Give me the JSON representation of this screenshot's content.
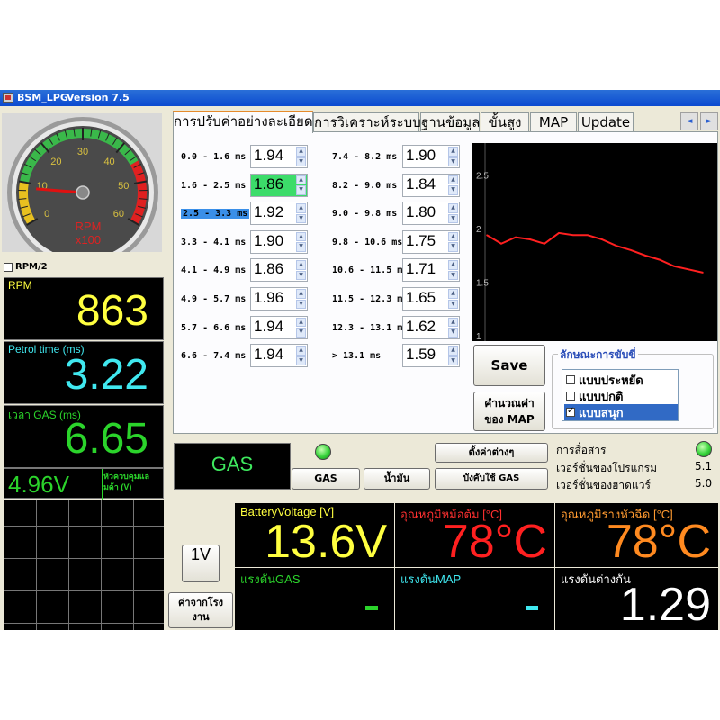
{
  "window": {
    "title": "BSM_LPG",
    "version": "Version 7.5"
  },
  "gauge": {
    "tick_labels": [
      "0",
      "10",
      "20",
      "30",
      "40",
      "50",
      "60"
    ],
    "unit_line1": "RPM",
    "unit_line2": "x100",
    "needle_value": 8.63
  },
  "rpm2": {
    "label": "RPM/2",
    "checked": false
  },
  "readouts": [
    {
      "label": "RPM",
      "value": "863",
      "label_color": "#ffff40",
      "value_color": "#ffff40"
    },
    {
      "label": "Petrol time (ms)",
      "value": "3.22",
      "label_color": "#40e8f0",
      "value_color": "#40e8f0"
    },
    {
      "label": "เวลา GAS (ms)",
      "value": "6.65",
      "label_color": "#2bd42b",
      "value_color": "#2bd42b"
    }
  ],
  "voltage": {
    "value": "4.96V",
    "label": "หัวควบคุมแลมด้า (V)"
  },
  "tabs": [
    "การปรับค่าอย่างละเอียด",
    "การวิเคราะห์ระบบ",
    "ฐานข้อมูล",
    "ขั้นสูง",
    "MAP",
    "Update"
  ],
  "tab_scroll": {
    "left": "◄",
    "right": "►"
  },
  "ranges_left": [
    {
      "label": "0.0 - 1.6 ms",
      "value": "1.94"
    },
    {
      "label": "1.6 - 2.5 ms",
      "value": "1.86"
    },
    {
      "label": "2.5 - 3.3 ms",
      "value": "1.92"
    },
    {
      "label": "3.3 - 4.1 ms",
      "value": "1.90"
    },
    {
      "label": "4.1 - 4.9 ms",
      "value": "1.86"
    },
    {
      "label": "4.9 - 5.7 ms",
      "value": "1.96"
    },
    {
      "label": "5.7 - 6.6 ms",
      "value": "1.94"
    },
    {
      "label": "6.6 - 7.4 ms",
      "value": "1.94"
    }
  ],
  "ranges_right": [
    {
      "label": "7.4 - 8.2 ms",
      "value": "1.90"
    },
    {
      "label": "8.2 - 9.0 ms",
      "value": "1.84"
    },
    {
      "label": "9.0 - 9.8 ms",
      "value": "1.80"
    },
    {
      "label": "9.8 - 10.6 ms",
      "value": "1.75"
    },
    {
      "label": "10.6 - 11.5 ms",
      "value": "1.71"
    },
    {
      "label": "11.5 - 12.3 ms",
      "value": "1.65"
    },
    {
      "label": "12.3 - 13.1 ms",
      "value": "1.62"
    },
    {
      "label": "> 13.1 ms",
      "value": "1.59"
    }
  ],
  "selected_range_index": 2,
  "highlighted_value_index": 1,
  "buttons": {
    "save": "Save",
    "calc_map_line1": "คำนวณค่า",
    "calc_map_line2": "ของ MAP",
    "set_various": "ตั้งค่าต่างๆ",
    "force_gas": "บังคับใช้ GAS",
    "gas": "GAS",
    "petrol": "น้ำมัน",
    "v1": "1V",
    "factory_line1": "ค่าจากโรง",
    "factory_line2": "งาน"
  },
  "drive_mode": {
    "title": "ลักษณะการขับขี่",
    "options": [
      {
        "label": "แบบประหยัด",
        "checked": false
      },
      {
        "label": "แบบปกติ",
        "checked": false
      },
      {
        "label": "แบบสนุก",
        "checked": true
      }
    ]
  },
  "fuel_status": "GAS",
  "status_info": {
    "comm_label": "การสื่อสาร",
    "program_version_label": "เวอร์ชั่นของโปรแกรม",
    "program_version": "5.1",
    "hardware_version_label": "เวอร์ชั่นของฮาดแวร์",
    "hardware_version": "5.0"
  },
  "panels": [
    {
      "label": "BatteryVoltage [V]",
      "value": "13.6V",
      "label_color": "#ffff40",
      "value_color": "#ffff40"
    },
    {
      "label": "อุณหภูมิหม้อต้ม [°C]",
      "value": "78°C",
      "label_color": "#ff3030",
      "value_color": "#ff2020"
    },
    {
      "label": "อุณหภูมิรางหัวฉีด [°C]",
      "value": "78°C",
      "label_color": "#ff9a30",
      "value_color": "#ff8a20"
    },
    {
      "label": "แรงดันGAS",
      "value": "",
      "label_color": "#2bd42b",
      "value_color": "#2bd42b"
    },
    {
      "label": "แรงดันMAP",
      "value": "",
      "label_color": "#40e8f0",
      "value_color": "#40e8f0"
    },
    {
      "label": "แรงดันต่างกัน",
      "value": "1.29",
      "label_color": "#ffffff",
      "value_color": "#ffffff"
    }
  ],
  "chart_data": {
    "type": "line",
    "x": [
      1,
      2,
      3,
      4,
      5,
      6,
      7,
      8,
      9,
      10,
      11,
      12,
      13,
      14,
      15,
      16
    ],
    "series": [
      {
        "values": [
          1.94,
          1.86,
          1.92,
          1.9,
          1.86,
          1.96,
          1.94,
          1.94,
          1.9,
          1.84,
          1.8,
          1.75,
          1.71,
          1.65,
          1.62,
          1.59
        ]
      }
    ],
    "y_ticks": [
      "1",
      "1.5",
      "2",
      "2.5"
    ],
    "ylim": [
      0.95,
      2.8
    ],
    "line_color": "#ff2020",
    "grid": false
  }
}
